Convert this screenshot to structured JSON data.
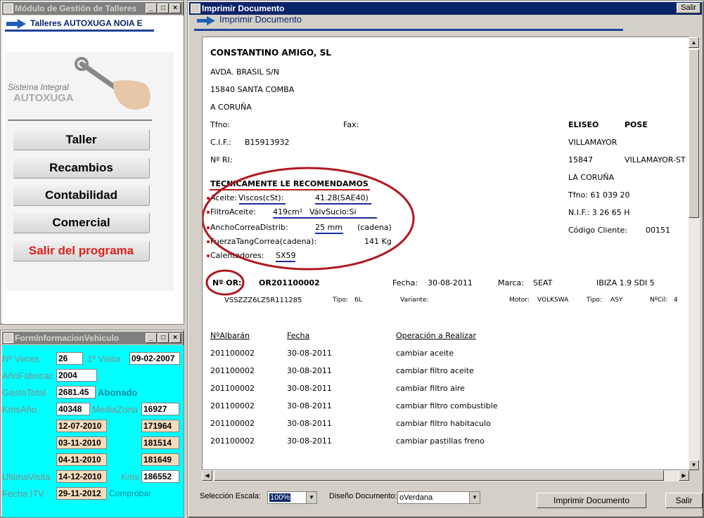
{
  "left_window": {
    "title": "Módulo de Gestión de Talleres",
    "header": "Talleres AUTOXUGA NOIA E",
    "logo_line1": "Sistema Integral",
    "logo_line2": "AUTOXUGA",
    "menu": [
      "Taller",
      "Recambios",
      "Contabilidad",
      "Comercial",
      "Salir del programa"
    ],
    "colors": {
      "exit": "#e0201a",
      "menu_text": "#000000"
    }
  },
  "info_window": {
    "title": "FormInformacionVehiculo",
    "labels": {
      "veces": "Nº Veces",
      "primera_visita": "1ª Visita",
      "anio": "AñoFabricac",
      "gasto": "GastoTotal",
      "abonado": "Abonado",
      "kms_anio": "KmsAño",
      "media_zona": "MediaZona",
      "ultima_visita": "UltimaVisita",
      "kms": "Kms",
      "fecha_itv": "Fecha ITV",
      "comprobar": "Comprobar"
    },
    "values": {
      "veces": "26",
      "primera_visita": "09-02-2007",
      "anio": "2004",
      "gasto": "2681.45",
      "kms_anio": "40348",
      "media_zona": "16927",
      "ultima_visita": "14-12-2010",
      "kms": "186552",
      "fecha_itv": "29-11-2012"
    },
    "history": [
      {
        "date": "12-07-2010",
        "kms": "171964"
      },
      {
        "date": "03-11-2010",
        "kms": "181514"
      },
      {
        "date": "04-11-2010",
        "kms": "181649"
      }
    ]
  },
  "main_window": {
    "title": "Imprimir Documento",
    "header": "Imprimir Documento",
    "exit_label": "Salir",
    "scale_label": "Selección Escala:",
    "scale_value": "100%",
    "design_label": "Diseño Documento:",
    "design_value": "oVerdana",
    "print_button": "Imprimir Documento",
    "close_button": "Salir"
  },
  "document": {
    "company": "CONSTANTINO AMIGO, SL",
    "address": "AVDA. BRASIL S/N",
    "zip_city": "15840   SANTA COMBA",
    "province": "A CORUÑA",
    "tfno_label": "Tfno:",
    "fax_label": "Fax:",
    "cif_label": "C.I.F.:",
    "cif": "B15913932",
    "nri_label": "Nº RI:",
    "client": {
      "name1": "ELISEO",
      "name2": "POSE",
      "street": "VILLAMAYOR",
      "zip": "15847",
      "city": "VILLAMAYOR-ST",
      "province": "LA CORUÑA",
      "tfno": "Tfno:  61  039  20",
      "nif": "N.I.F.:  3  26  65  H",
      "code_label": "Código Cliente:",
      "code": "00151"
    },
    "recommend": {
      "title": "TECNICAMENTE LE RECOMENDAMOS",
      "aceite_label": "Aceite:",
      "viscos_label": "Viscos(cSt):",
      "viscos_value": "41.28(SAE40)",
      "filtro_label": "FiltroAceite:",
      "filtro_value": "419cm²",
      "valv_label": "VálvSucio:Si",
      "correa_label": "AnchoCorreaDistrib:",
      "correa_value": "25 mm",
      "correa_note": "(cadena)",
      "fuerza_label": "FuerzaTangCorrea(cadena):",
      "fuerza_value": "141 Kg",
      "calent_label": "Calentadores:",
      "calent_value": "SX59"
    },
    "order": {
      "label": "Nº OR:",
      "number": "OR201100002",
      "fecha_label": "Fecha:",
      "fecha": "30-08-2011",
      "marca_label": "Marca:",
      "marca": "SEAT",
      "modelo": "IBIZA 1.9 SDI 5",
      "vin": "VSSZZZ6LZ5R111285",
      "tipo_label": "Tipo:",
      "tipo": "6L",
      "variante_label": "Variante:",
      "motor_label": "Motor:",
      "motor": "VOLKSWA",
      "tipo2_label": "Tipo:",
      "tipo2": "ASY",
      "ncil_label": "NºCil:",
      "ncil": "4"
    },
    "table": {
      "headers": [
        "NºAlbarán",
        "Fecha",
        "Operación a Realizar"
      ],
      "rows": [
        [
          "201100002",
          "30-08-2011",
          "cambiar aceite"
        ],
        [
          "201100002",
          "30-08-2011",
          "cambiar filtro aceite"
        ],
        [
          "201100002",
          "30-08-2011",
          "cambiar filtro aire"
        ],
        [
          "201100002",
          "30-08-2011",
          "cambiar filtro combustible"
        ],
        [
          "201100002",
          "30-08-2011",
          "cambiar filtro habitaculo"
        ],
        [
          "201100002",
          "30-08-2011",
          "cambiar pastillas freno"
        ]
      ]
    }
  }
}
